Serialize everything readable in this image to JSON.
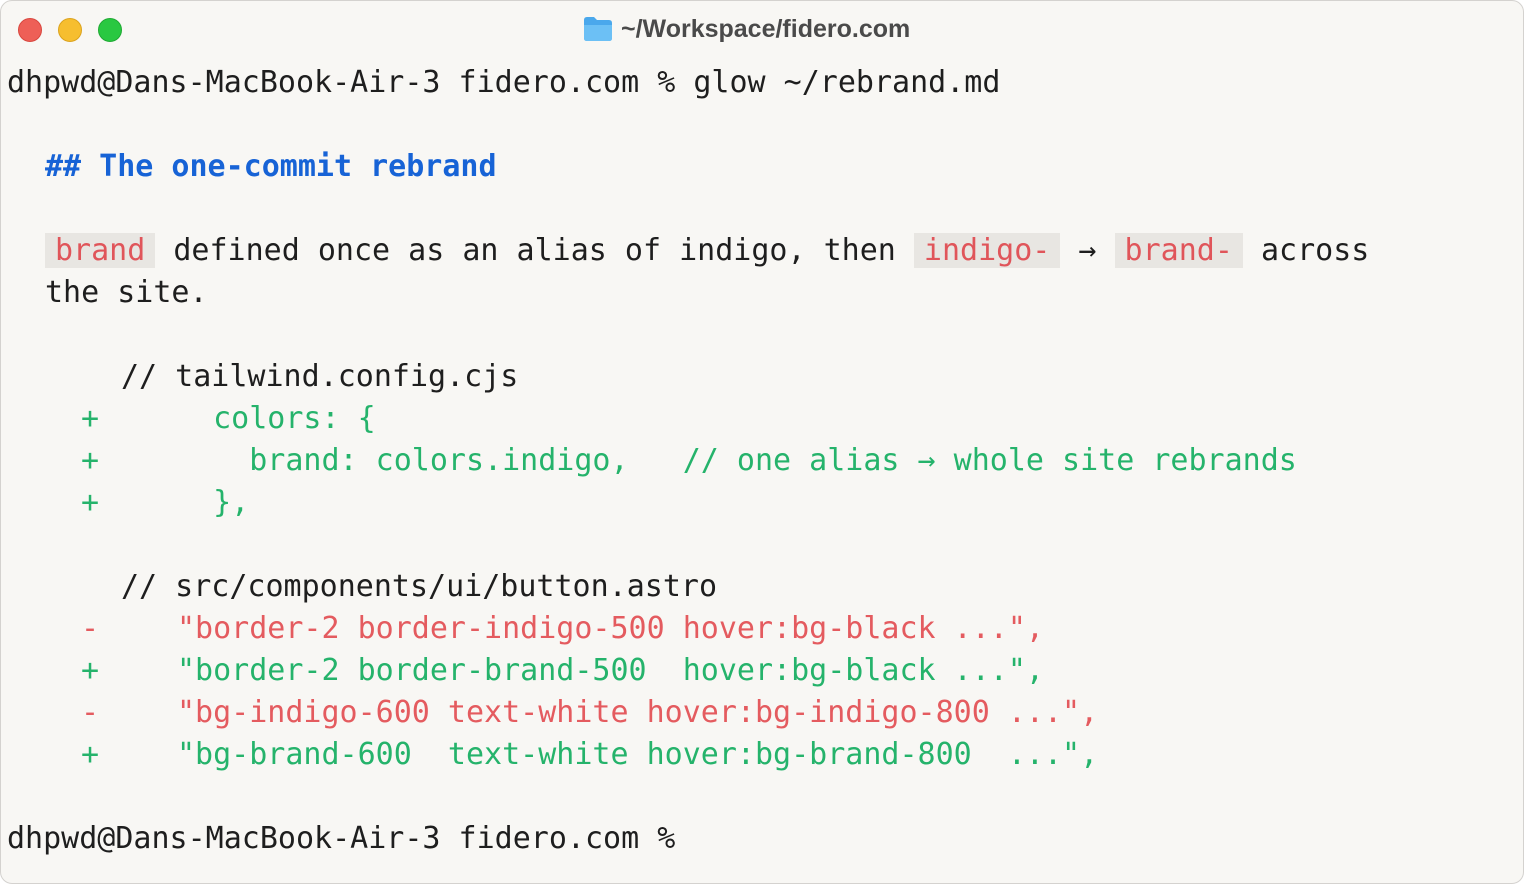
{
  "window": {
    "title": "~/Workspace/fidero.com",
    "controls": [
      "close",
      "minimize",
      "maximize"
    ],
    "icon": "folder-icon"
  },
  "terminal": {
    "prompt_command": "dhpwd@Dans-MacBook-Air-3 fidero.com % glow ~/rebrand.md",
    "heading": "## The one-commit rebrand",
    "para": {
      "chip1": "brand",
      "text1": "defined once as an alias of indigo, then",
      "chip2": "indigo-",
      "arrow": "→",
      "chip3": "brand-",
      "text2": "across",
      "text3": "the site."
    },
    "block1": {
      "comment": "// tailwind.config.cjs",
      "lines": [
        {
          "sign": "+",
          "code": "  colors: {"
        },
        {
          "sign": "+",
          "code": "    brand: colors.indigo,   // one alias → whole site rebrands"
        },
        {
          "sign": "+",
          "code": "  },"
        }
      ]
    },
    "block2": {
      "comment": "// src/components/ui/button.astro",
      "lines": [
        {
          "sign": "-",
          "code": "\"border-2 border-indigo-500 hover:bg-black ...\","
        },
        {
          "sign": "+",
          "code": "\"border-2 border-brand-500  hover:bg-black ...\","
        },
        {
          "sign": "-",
          "code": "\"bg-indigo-600 text-white hover:bg-indigo-800 ...\","
        },
        {
          "sign": "+",
          "code": "\"bg-brand-600  text-white hover:bg-brand-800  ...\","
        }
      ]
    },
    "prompt_final": "dhpwd@Dans-MacBook-Air-3 fidero.com %"
  }
}
